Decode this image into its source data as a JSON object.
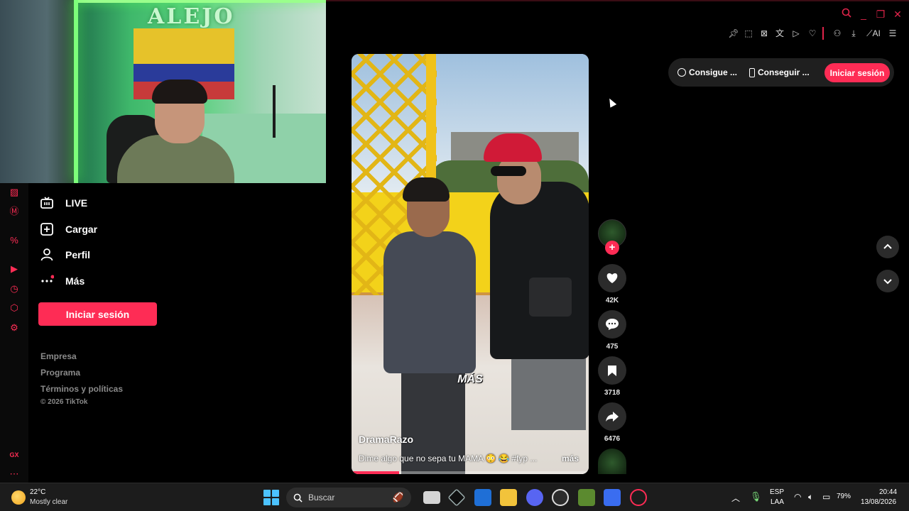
{
  "webcam": {
    "sign_text": "ALEJO"
  },
  "sidebar": {
    "items": [
      {
        "label": "LIVE",
        "icon": "live-tv-icon"
      },
      {
        "label": "Cargar",
        "icon": "upload-plus-icon"
      },
      {
        "label": "Perfil",
        "icon": "user-icon"
      },
      {
        "label": "Más",
        "icon": "more-dots-icon"
      }
    ],
    "login_label": "Iniciar sesión",
    "footer_links": [
      "Empresa",
      "Programa",
      "Términos y políticas"
    ],
    "copyright": "© 2026 TikTok"
  },
  "promo": {
    "coins_label": "Consigue ...",
    "app_label": "Conseguir ...",
    "login_label": "Iniciar sesión"
  },
  "video": {
    "caption_word": "MÁS",
    "author": "DramaRazo",
    "description": "Dime algo que no sepa tu MAMA 😳 😂 #fyp ...",
    "more_label": "más",
    "progress": 0.2
  },
  "actions": {
    "likes": "42K",
    "comments": "475",
    "saves": "3718",
    "shares": "6476"
  },
  "taskbar": {
    "temperature": "22°C",
    "weather": "Mostly clear",
    "search_placeholder": "Buscar",
    "language_top": "ESP",
    "language_bottom": "LAA",
    "battery": "79%",
    "time": "20:44",
    "date": "13/08/2026"
  },
  "colors": {
    "accent": "#fe2c55",
    "background": "#000000",
    "taskbar": "#1c1c1c"
  }
}
